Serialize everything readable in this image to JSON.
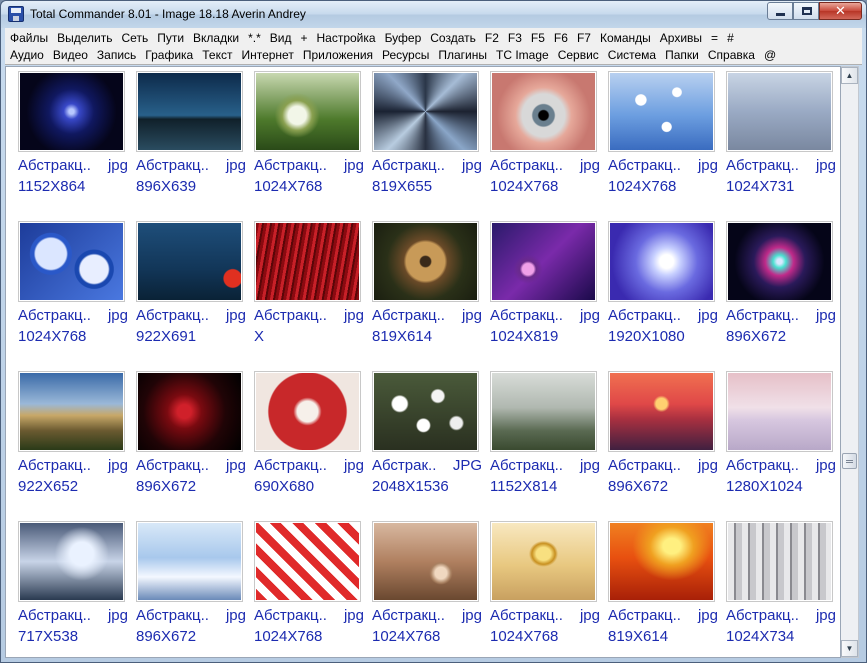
{
  "window": {
    "title": "Total Commander 8.01 - Image 18.18 Averin Andrey"
  },
  "caption_buttons": {
    "minimize": "_",
    "maximize": "□",
    "close": "✕"
  },
  "menu": [
    "Файлы",
    "Выделить",
    "Сеть",
    "Пути",
    "Вкладки",
    "*.*",
    "Вид",
    "+",
    "Настройка",
    "Буфер",
    "Создать",
    "F2",
    "F3",
    "F5",
    "F6",
    "F7",
    "Команды",
    "Архивы",
    "=",
    "#"
  ],
  "buttonbar": [
    "Аудио",
    "Видео",
    "Запись",
    "Графика",
    "Текст",
    "Интернет",
    "Приложения",
    "Ресурсы",
    "Плагины",
    "TC Image",
    "Сервис",
    "Система",
    "Папки",
    "Справка",
    "@"
  ],
  "scrollbar": {
    "up_icon": "▲",
    "down_icon": "▼",
    "position": 0.68
  },
  "items": [
    {
      "name": "Абстракц..",
      "ext": "jpg",
      "res": "1152X864",
      "art": "swirl-blue"
    },
    {
      "name": "Абстракц..",
      "ext": "jpg",
      "res": "896X639",
      "art": "palms-night"
    },
    {
      "name": "Абстракц..",
      "ext": "jpg",
      "res": "1024X768",
      "art": "green-sphere"
    },
    {
      "name": "Абстракц..",
      "ext": "jpg",
      "res": "819X655",
      "art": "kaleido-steel"
    },
    {
      "name": "Абстракц..",
      "ext": "jpg",
      "res": "1024X768",
      "art": "eye"
    },
    {
      "name": "Абстракц..",
      "ext": "jpg",
      "res": "1024X768",
      "art": "eyeballs-sea"
    },
    {
      "name": "Абстракц..",
      "ext": "jpg",
      "res": "1024X731",
      "art": "misty-blue"
    },
    {
      "name": "Абстракц..",
      "ext": "jpg",
      "res": "1024X768",
      "art": "clocks-blue"
    },
    {
      "name": "Абстракц..",
      "ext": "jpg",
      "res": "922X691",
      "art": "opera-blue"
    },
    {
      "name": "Абстракц..",
      "ext": "jpg",
      "res": "X",
      "art": "red-lines"
    },
    {
      "name": "Абстракц..",
      "ext": "jpg",
      "res": "819X614",
      "art": "bronze-disc"
    },
    {
      "name": "Абстракц..",
      "ext": "jpg",
      "res": "1024X819",
      "art": "purple-tubes"
    },
    {
      "name": "Абстракц..",
      "ext": "jpg",
      "res": "1920X1080",
      "art": "light-burst"
    },
    {
      "name": "Абстракц..",
      "ext": "jpg",
      "res": "896X672",
      "art": "fractal-star"
    },
    {
      "name": "Абстракц..",
      "ext": "jpg",
      "res": "922X652",
      "art": "mountain"
    },
    {
      "name": "Абстракц..",
      "ext": "jpg",
      "res": "896X672",
      "art": "red-dark"
    },
    {
      "name": "Абстракц..",
      "ext": "jpg",
      "res": "690X680",
      "art": "red-dragon"
    },
    {
      "name": "Абстрак..",
      "ext": "JPG",
      "res": "2048X1536",
      "art": "white-flowers"
    },
    {
      "name": "Абстракц..",
      "ext": "jpg",
      "res": "1152X814",
      "art": "foggy-temple"
    },
    {
      "name": "Абстракц..",
      "ext": "jpg",
      "res": "896X672",
      "art": "sunset-sea"
    },
    {
      "name": "Абстракц..",
      "ext": "jpg",
      "res": "1280X1024",
      "art": "pink-water"
    },
    {
      "name": "Абстракц..",
      "ext": "jpg",
      "res": "717X538",
      "art": "ice-cave"
    },
    {
      "name": "Абстракц..",
      "ext": "jpg",
      "res": "896X672",
      "art": "ice-penguins"
    },
    {
      "name": "Абстракц..",
      "ext": "jpg",
      "res": "1024X768",
      "art": "candy-canes"
    },
    {
      "name": "Абстракц..",
      "ext": "jpg",
      "res": "1024X768",
      "art": "brown-spheres"
    },
    {
      "name": "Абстракц..",
      "ext": "jpg",
      "res": "1024X768",
      "art": "gold-rings"
    },
    {
      "name": "Абстракц..",
      "ext": "jpg",
      "res": "819X614",
      "art": "fire-wave"
    },
    {
      "name": "Абстракц..",
      "ext": "jpg",
      "res": "1024X734",
      "art": "stone-temple"
    }
  ]
}
